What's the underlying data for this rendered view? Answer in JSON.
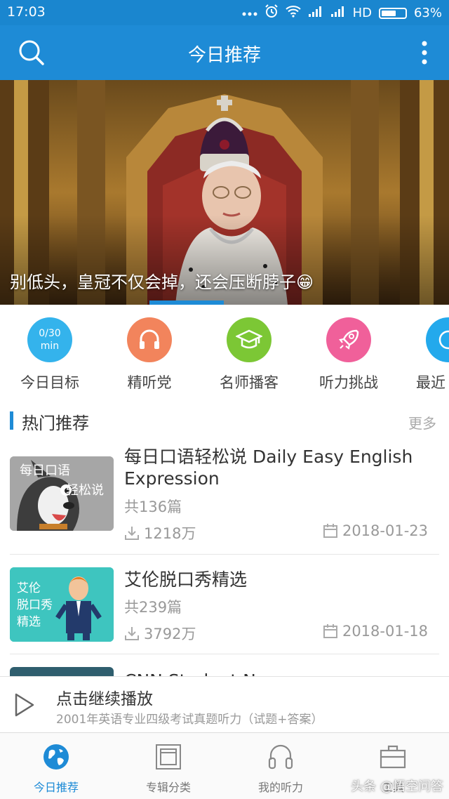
{
  "status_bar": {
    "time": "17:03",
    "network": "HD",
    "battery": "63%",
    "battery_level": 0.63
  },
  "app_bar": {
    "title": "今日推荐",
    "left_icon": "search-icon",
    "right_icon": "more-vertical-icon"
  },
  "banner": {
    "caption": "别低头，皇冠不仅会掉，还会压断脖子😁",
    "colors": {
      "indicator": "#1e8bd6"
    }
  },
  "quick_entries": [
    {
      "label": "今日目标",
      "icon": "goal-progress-icon",
      "progress": "0/30",
      "unit": "min",
      "color": "#34b3ec"
    },
    {
      "label": "精听党",
      "icon": "headphones-icon",
      "color": "#f2845c"
    },
    {
      "label": "名师播客",
      "icon": "graduation-cap-icon",
      "color": "#7cc735"
    },
    {
      "label": "听力挑战",
      "icon": "rocket-icon",
      "color": "#f0609a"
    },
    {
      "label": "最近",
      "icon": "clock-icon",
      "color": "#23a9ec"
    }
  ],
  "section": {
    "title": "热门推荐",
    "more": "更多"
  },
  "list": [
    {
      "title": "每日口语轻松说 Daily Easy English Expression",
      "count": "共136篇",
      "plays": "1218万",
      "date": "2018-01-23",
      "thumb_text_1": "每日口语",
      "thumb_text_2": "轻松说"
    },
    {
      "title": "艾伦脱口秀精选",
      "count": "共239篇",
      "plays": "3792万",
      "date": "2018-01-18",
      "thumb_text_1": "艾伦",
      "thumb_text_2": "脱口秀",
      "thumb_text_3": "精选"
    },
    {
      "title": "CNN Student News"
    }
  ],
  "player": {
    "title": "点击继续播放",
    "subtitle": "2001年英语专业四级考试真题听力（试题+答案）"
  },
  "tabs": [
    {
      "label": "今日推荐",
      "icon": "globe-icon",
      "active": true
    },
    {
      "label": "专辑分类",
      "icon": "album-icon",
      "active": false
    },
    {
      "label": "我的听力",
      "icon": "headphones-icon",
      "active": false
    },
    {
      "label": "工具",
      "icon": "toolbox-icon",
      "active": false
    }
  ],
  "watermark": "头条 @悟空问答"
}
